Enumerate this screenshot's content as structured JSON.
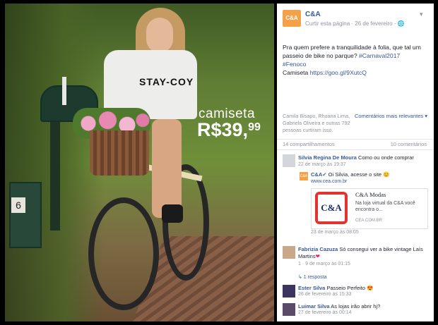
{
  "photo": {
    "shirt_text": "STAY-COY",
    "mailbox_number": "6",
    "price_label": "camiseta",
    "price_main": "R$39,",
    "price_cents": "99"
  },
  "post": {
    "page_name": "C&A",
    "logo_text": "C&A",
    "meta": "Curtir esta página · 26 de fevereiro · ",
    "text_line1": "Pra quem prefere a tranquilidade à folia, que tal um passeio de bike no parque? ",
    "hashtag_carnaval": "#Carnaval2017",
    "hashtag_partido": "#Fenoco",
    "shirt_label": "Camiseta ",
    "shirt_link": "https://goo.gl/9XutcQ",
    "reactions": "Camila Bisapo, Rhuana Lima, Gabriela Oliveira e outras 792 pessoas curtiram isso.",
    "relevant": "Comentários mais relevantes ▾",
    "shares": "14 compartilhamentos",
    "comments_count": "10 comentários"
  },
  "comments": [
    {
      "name": "Silvia Regina De Moura",
      "text": " Como ou onde comprar",
      "meta": "22 de março às 19:37"
    },
    {
      "name": "Fabrizia Cazuza",
      "text": " Só consegui ver a bike vintage Laís Martins",
      "meta": "1 · 9 de março às 01:15",
      "reply": "↳ 1 resposta"
    },
    {
      "name": "Ester Silva",
      "text": " Passeio Perfeito 😍",
      "meta": "26 de fevereiro às 15:33"
    },
    {
      "name": "Luimar Silva",
      "text": " As lojas irão abrir hj?",
      "meta": "27 de fevereiro às 00:14"
    }
  ],
  "reply": {
    "name": "C&A",
    "text": " Oi Silvia, acesse o site 😊",
    "url": "www.cea.com.br",
    "preview_logo": "C&A",
    "preview_title": "C&A Modas",
    "preview_desc": "Na loja virtual da C&A você encontra o...",
    "preview_domain": "CEA.COM.BR",
    "date": "23 de março às 08:05"
  }
}
